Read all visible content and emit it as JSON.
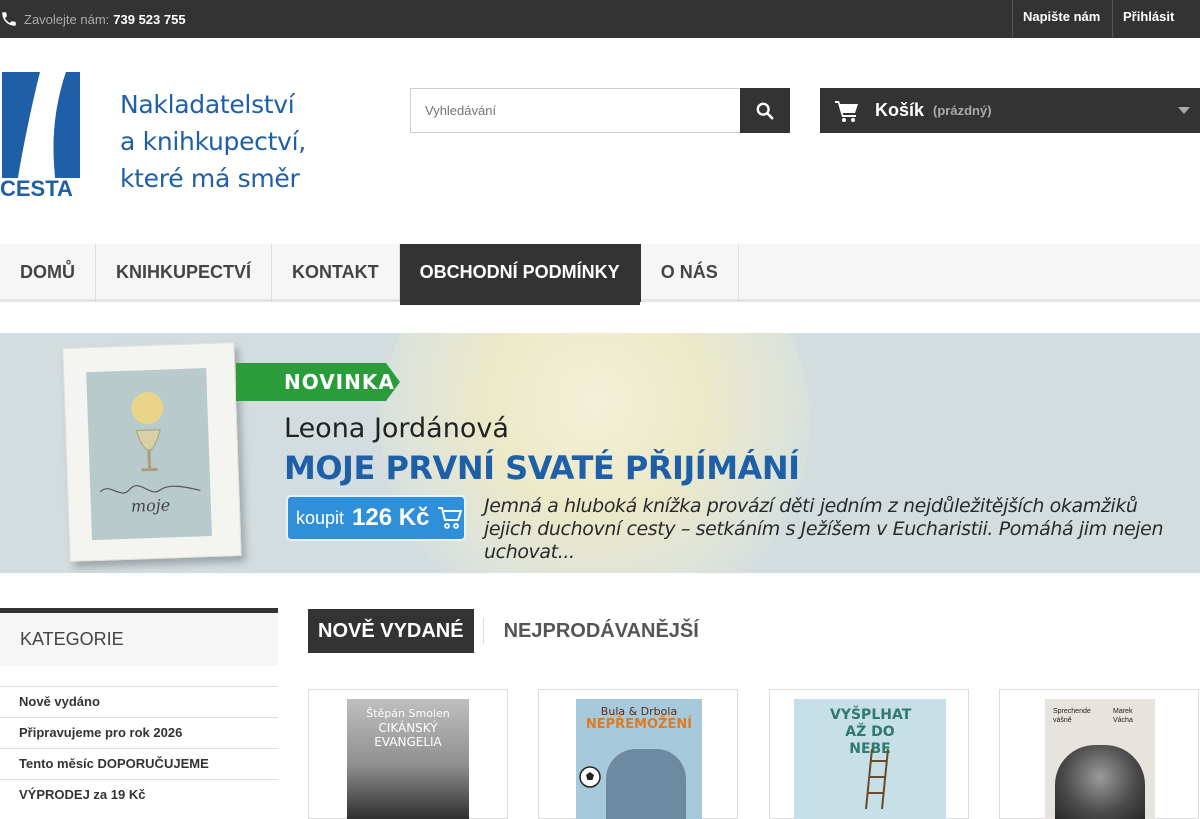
{
  "topbar": {
    "phone_label": "Zavolejte nám:",
    "phone_number": "739 523 755",
    "contact_link": "Napište nám",
    "login_link": "Přihlásit se"
  },
  "header": {
    "logo_text": "CESTA",
    "tagline_line1": "Nakladatelství",
    "tagline_line2": "a knihkupectví,",
    "tagline_line3": "které má směr",
    "search_placeholder": "Vyhledávání",
    "cart_title": "Košík",
    "cart_status": "(prázdný)"
  },
  "nav": {
    "items": [
      {
        "label": "DOMŮ",
        "active": false
      },
      {
        "label": "KNIHKUPECTVÍ",
        "active": false
      },
      {
        "label": "KONTAKT",
        "active": false
      },
      {
        "label": "OBCHODNÍ PODMÍNKY",
        "active": true
      },
      {
        "label": "O NÁS",
        "active": false
      }
    ]
  },
  "banner": {
    "badge": "NOVINKA",
    "author": "Leona Jordánová",
    "title": "MOJE PRVNÍ SVATÉ PŘIJÍMÁNÍ",
    "buy_label": "koupit",
    "price": "126 Kč",
    "description": "Jemná a hluboká knížka provází děti jedním z nejdůležitějších okamžiků jejich duchovní cesty – setkáním s Ježíšem v Eucharistii. Pomáhá jim nejen uchovat...",
    "book_cover_text": "moje"
  },
  "sidebar": {
    "title": "KATEGORIE",
    "items": [
      "Nově vydáno",
      "Připravujeme pro rok 2026",
      "Tento měsíc DOPORUČUJEME",
      "VÝPRODEJ za 19 Kč"
    ]
  },
  "tabs": {
    "active": "NOVĚ VYDANÉ",
    "other": "NEJPRODÁVANĚJŠÍ"
  },
  "products": [
    {
      "cover_author": "Štěpán Smolen",
      "cover_title": "CIKÁNSKÝ EVANGELIA"
    },
    {
      "cover_author": "Bula & Drbola",
      "cover_title": "NEPŘEMOŽENÍ"
    },
    {
      "cover_author": "",
      "cover_title": "VYŠPLHAT AŽ DO NEBE"
    },
    {
      "cover_author": "Marek Vácha",
      "cover_title": "Sprechende vášně"
    }
  ],
  "colors": {
    "dark": "#333333",
    "brand_blue": "#1f5fa8",
    "badge_green": "#2a9d3a",
    "buy_blue": "#2f8fd8"
  }
}
